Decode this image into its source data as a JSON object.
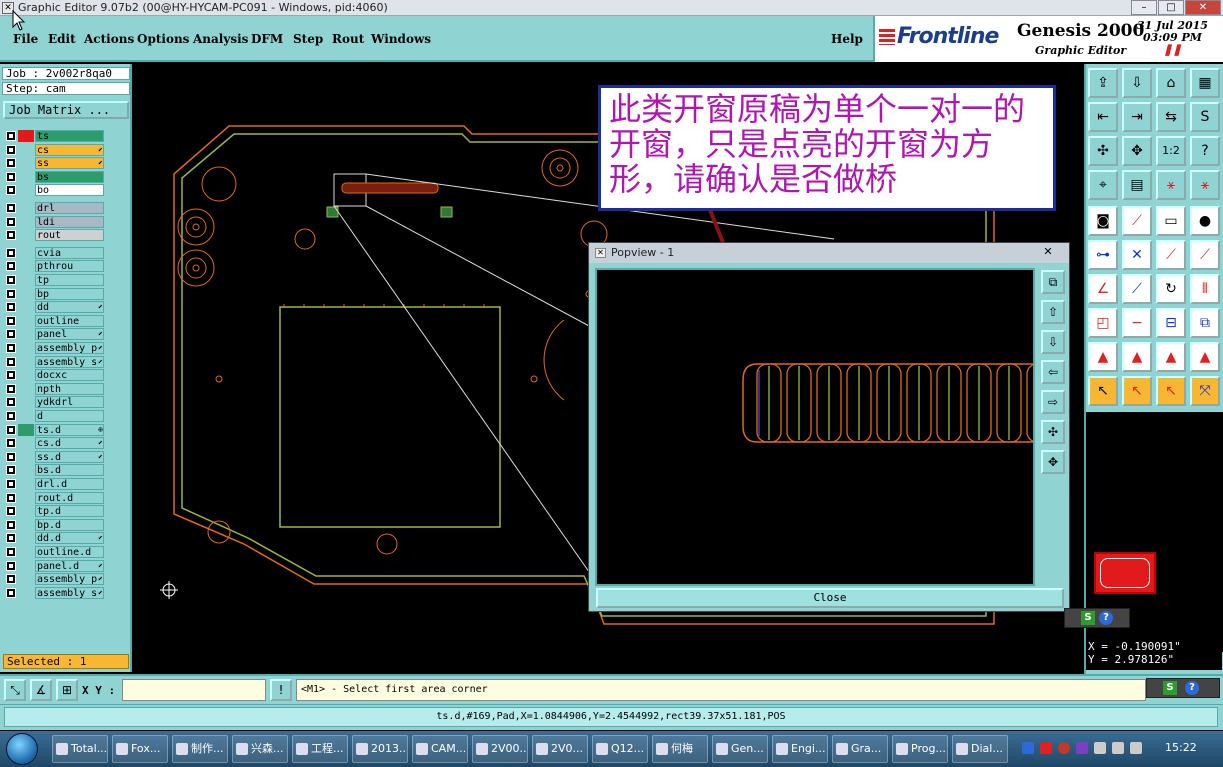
{
  "window": {
    "title": "Graphic Editor 9.07b2 (00@HY-HYCAM-PC091 - Windows, pid:4060)",
    "controls": [
      "–",
      "□",
      "✕"
    ]
  },
  "menu": {
    "items": [
      "File",
      "Edit",
      "Actions",
      "Options",
      "Analysis",
      "DFM",
      "Step",
      "Rout",
      "Windows"
    ],
    "help": "Help"
  },
  "brand": {
    "frontline": "Frontline",
    "product": "Genesis 2000",
    "subtitle": "Graphic Editor",
    "date": "31 Jul 2015",
    "time": "03:09 PM"
  },
  "left": {
    "job": "Job : 2v002r8qa0",
    "step": "Step: cam",
    "job_matrix": "Job Matrix ...",
    "layers": [
      {
        "name": "ts",
        "swatch": "#e31a1c",
        "bg": "#2e9b6b",
        "mark": ""
      },
      {
        "name": "cs",
        "swatch": "",
        "bg": "#f7b733",
        "mark": "⬋"
      },
      {
        "name": "ss",
        "swatch": "",
        "bg": "#f7b733",
        "mark": "⬋"
      },
      {
        "name": "bs",
        "swatch": "",
        "bg": "#2e9b6b",
        "mark": ""
      },
      {
        "name": "bo",
        "swatch": "",
        "bg": "#ffffff",
        "mark": ""
      },
      {
        "name": "drl",
        "swatch": "",
        "bg": "#a8b8c4",
        "mark": ""
      },
      {
        "name": "ldi",
        "swatch": "",
        "bg": "#a8b8c4",
        "mark": ""
      },
      {
        "name": "rout",
        "swatch": "",
        "bg": "#d0d0d0",
        "mark": ""
      },
      {
        "name": "cvia",
        "swatch": "",
        "bg": "",
        "mark": ""
      },
      {
        "name": "pthrou",
        "swatch": "",
        "bg": "",
        "mark": ""
      },
      {
        "name": "tp",
        "swatch": "",
        "bg": "",
        "mark": ""
      },
      {
        "name": "bp",
        "swatch": "",
        "bg": "",
        "mark": ""
      },
      {
        "name": "dd",
        "swatch": "",
        "bg": "",
        "mark": "⬋"
      },
      {
        "name": "outline",
        "swatch": "",
        "bg": "",
        "mark": ""
      },
      {
        "name": "panel",
        "swatch": "",
        "bg": "",
        "mark": "⬋"
      },
      {
        "name": "assembly_p",
        "swatch": "",
        "bg": "",
        "mark": "⬋"
      },
      {
        "name": "assembly_s",
        "swatch": "",
        "bg": "",
        "mark": "⬋"
      },
      {
        "name": "docxc",
        "swatch": "",
        "bg": "",
        "mark": ""
      },
      {
        "name": "npth",
        "swatch": "",
        "bg": "",
        "mark": ""
      },
      {
        "name": "ydkdrl",
        "swatch": "",
        "bg": "",
        "mark": ""
      },
      {
        "name": "d",
        "swatch": "",
        "bg": "",
        "mark": ""
      },
      {
        "name": "ts.d",
        "swatch": "#2e9b6b",
        "bg": "",
        "mark": "⊕"
      },
      {
        "name": "cs.d",
        "swatch": "",
        "bg": "",
        "mark": "⬋"
      },
      {
        "name": "ss.d",
        "swatch": "",
        "bg": "",
        "mark": "⬋"
      },
      {
        "name": "bs.d",
        "swatch": "",
        "bg": "",
        "mark": ""
      },
      {
        "name": "drl.d",
        "swatch": "",
        "bg": "",
        "mark": ""
      },
      {
        "name": "rout.d",
        "swatch": "",
        "bg": "",
        "mark": ""
      },
      {
        "name": "tp.d",
        "swatch": "",
        "bg": "",
        "mark": ""
      },
      {
        "name": "bp.d",
        "swatch": "",
        "bg": "",
        "mark": ""
      },
      {
        "name": "dd.d",
        "swatch": "",
        "bg": "",
        "mark": "⬋"
      },
      {
        "name": "outline.d",
        "swatch": "",
        "bg": "",
        "mark": ""
      },
      {
        "name": "panel.d",
        "swatch": "",
        "bg": "",
        "mark": "⬋"
      },
      {
        "name": "assembly_p",
        "swatch": "",
        "bg": "",
        "mark": "⬋"
      },
      {
        "name": "assembly_s",
        "swatch": "",
        "bg": "",
        "mark": "⬋"
      }
    ],
    "selected": "Selected : 1"
  },
  "callout": {
    "text": "此类开窗原稿为单个一对一的开窗，只是点亮的开窗为方形，请确认是否做桥"
  },
  "popview": {
    "title": "Popview - 1",
    "close_x": "✕",
    "close_button": "Close"
  },
  "coords": {
    "x": "X = -0.190091\"",
    "y": "Y = 2.978126\""
  },
  "command": {
    "xy_label": "X Y :",
    "xy_value": "",
    "prompt": "<M1> - Select first area corner"
  },
  "status": {
    "text": "ts.d,#169,Pad,X=1.0844906,Y=2.4544992,rect39.37x51.181,POS"
  },
  "taskbar": {
    "items": [
      "Total...",
      "Fox...",
      "制作...",
      "兴森...",
      "工程...",
      "2013...",
      "CAM...",
      "2V00...",
      "2V0...",
      "Q12...",
      "何梅",
      "Gen...",
      "Engi...",
      "Gra...",
      "Prog...",
      "Dial..."
    ],
    "clock": "15:22"
  },
  "colors": {
    "panel": "#8fd3d3",
    "canvas": "#000000",
    "outline_orange": "#e06a1a",
    "outline_green": "#9bb83c",
    "callout_text": "#b016b0",
    "callout_border": "#1c2c9c",
    "arrow": "#8b1010"
  }
}
